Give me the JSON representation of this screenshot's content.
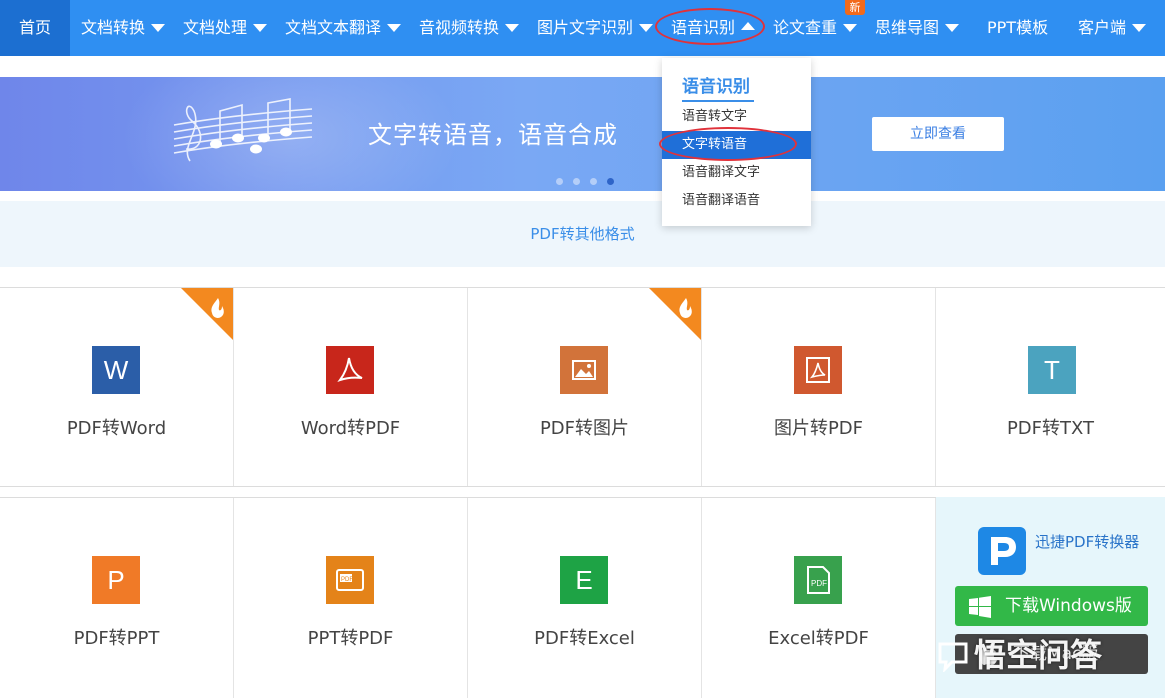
{
  "nav": {
    "home": "首页",
    "items": [
      {
        "label": "文档转换"
      },
      {
        "label": "文档处理"
      },
      {
        "label": "文档文本翻译"
      },
      {
        "label": "音视频转换"
      },
      {
        "label": "图片文字识别"
      },
      {
        "label": "语音识别"
      },
      {
        "label": "论文查重"
      },
      {
        "label": "思维导图"
      },
      {
        "label": "PPT模板"
      },
      {
        "label": "客户端"
      }
    ],
    "new_badge": "新"
  },
  "dropdown": {
    "title": "语音识别",
    "items": [
      "语音转文字",
      "文字转语音",
      "语音翻译文字",
      "语音翻译语音"
    ],
    "active_index": 1
  },
  "banner": {
    "text": "文字转语音，语音合成",
    "button": "立即查看",
    "slides": 4,
    "active_slide": 4
  },
  "section": {
    "title": "PDF转其他格式"
  },
  "tools_row1": [
    {
      "label": "PDF转Word",
      "glyph": "W",
      "color": "#2b5ea8",
      "hot": true
    },
    {
      "label": "Word转PDF",
      "glyph": "pdf",
      "color": "#c8261b",
      "hot": false
    },
    {
      "label": "PDF转图片",
      "glyph": "image",
      "color": "#d2733a",
      "hot": true
    },
    {
      "label": "图片转PDF",
      "glyph": "pdf",
      "color": "#d0582f",
      "hot": false
    },
    {
      "label": "PDF转TXT",
      "glyph": "T",
      "color": "#4ba3bf",
      "hot": false
    }
  ],
  "tools_row2": [
    {
      "label": "PDF转PPT",
      "glyph": "P",
      "color": "#f07a27"
    },
    {
      "label": "PPT转PDF",
      "glyph": "ppt-pdf",
      "color": "#e48319"
    },
    {
      "label": "PDF转Excel",
      "glyph": "E",
      "color": "#1ea345"
    },
    {
      "label": "Excel转PDF",
      "glyph": "pdf-doc",
      "color": "#38a14d"
    }
  ],
  "download": {
    "app_name": "迅捷PDF转换器",
    "windows_button": "下载Windows版",
    "mac_button": "下载Mac版"
  },
  "watermark": "悟空问答"
}
